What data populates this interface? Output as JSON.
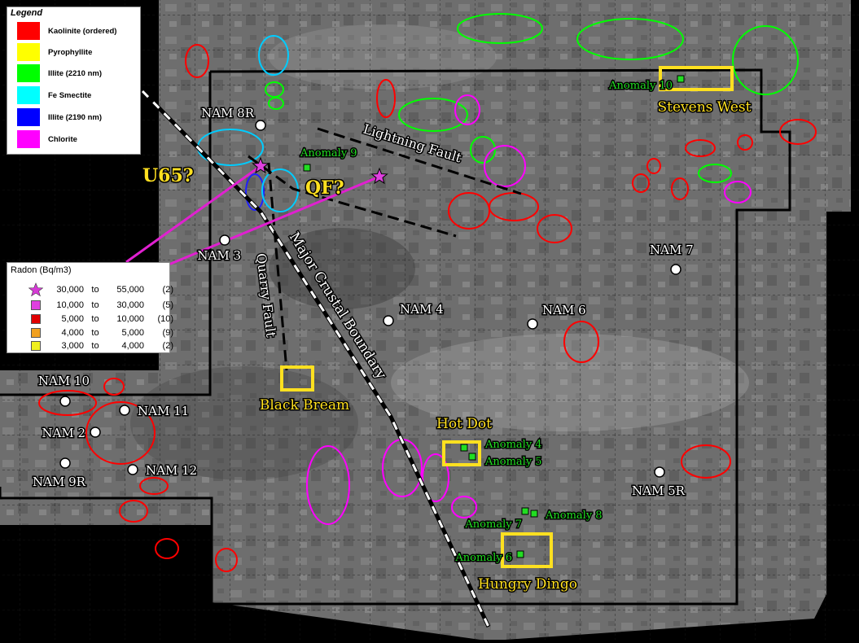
{
  "mineral_legend": {
    "title": "Legend",
    "items": [
      {
        "label": "Kaolinite (ordered)",
        "color": "#ff0000"
      },
      {
        "label": "Pyrophyllite",
        "color": "#ffff00"
      },
      {
        "label": "Illite (2210 nm)",
        "color": "#00ff00"
      },
      {
        "label": "Fe Smectite",
        "color": "#00ffff"
      },
      {
        "label": "Illite (2190 nm)",
        "color": "#0000ff"
      },
      {
        "label": "Chlorite",
        "color": "#ff00ff"
      }
    ]
  },
  "radon_legend": {
    "title": "Radon (Bq/m3)",
    "rows": [
      {
        "symbol": "star",
        "color": "#d63bd6",
        "from": "30,000",
        "to_word": "to",
        "to": "55,000",
        "count": "(2)"
      },
      {
        "symbol": "square",
        "color": "#e040e0",
        "from": "10,000",
        "to_word": "to",
        "to": "30,000",
        "count": "(5)"
      },
      {
        "symbol": "square",
        "color": "#e00000",
        "from": "5,000",
        "to_word": "to",
        "to": "10,000",
        "count": "(10)"
      },
      {
        "symbol": "square",
        "color": "#f0a020",
        "from": "4,000",
        "to_word": "to",
        "to": "5,000",
        "count": "(9)"
      },
      {
        "symbol": "square",
        "color": "#f0f020",
        "from": "3,000",
        "to_word": "to",
        "to": "4,000",
        "count": "(2)"
      }
    ]
  },
  "drillholes": [
    "NAM 8R",
    "NAM 3",
    "NAM 4",
    "NAM 6",
    "NAM 7",
    "NAM 10",
    "NAM 11",
    "NAM 2",
    "NAM 9R",
    "NAM 12",
    "NAM 5R"
  ],
  "prospects": [
    "Stevens West",
    "Black Bream",
    "Hot Dot",
    "Hungry Dingo"
  ],
  "anomalies": [
    "Anomaly 10",
    "Anomaly 9",
    "Anomaly 4",
    "Anomaly 5",
    "Anomaly 7",
    "Anomaly 8",
    "Anomaly 6"
  ],
  "structures": {
    "lightning_fault": "Lightning Fault",
    "quarry_fault": "Quarry Fault",
    "crustal_boundary": "Major Crustal Boundary",
    "u65": "U65?",
    "qf": "QF?"
  },
  "colors": {
    "drillhole": "#ffffff",
    "prospect": "#ffe020",
    "anomaly": "#22dd22",
    "kaolinite": "#ff0000",
    "illite": "#00ff00",
    "smectite": "#00ffff",
    "chlorite": "#ff00ff",
    "illite2190": "#0000ff"
  }
}
